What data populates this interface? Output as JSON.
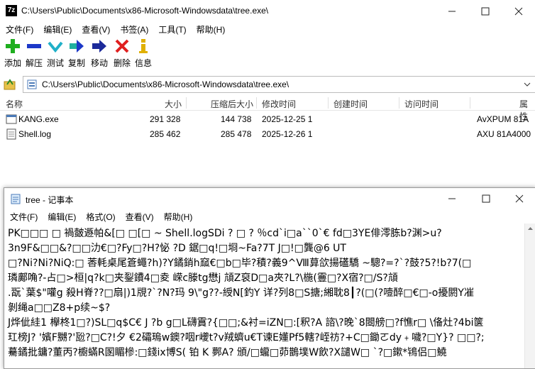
{
  "zip": {
    "title": "C:\\Users\\Public\\Documents\\x86-Microsoft-Windowsdata\\tree.exe\\",
    "menu": [
      "文件(F)",
      "编辑(E)",
      "查看(V)",
      "书签(A)",
      "工具(T)",
      "帮助(H)"
    ],
    "toolbar": [
      "添加",
      "解压",
      "测试",
      "复制",
      "移动",
      "删除",
      "信息"
    ],
    "address": "C:\\Users\\Public\\Documents\\x86-Microsoft-Windowsdata\\tree.exe\\",
    "columns": [
      "名称",
      "大小",
      "压缩后大小",
      "修改时间",
      "创建时间",
      "访问时间",
      "属性"
    ],
    "files": [
      {
        "name": "KANG.exe",
        "size": "291 328",
        "packed": "144 738",
        "modified": "2025-12-25 1",
        "attr": "AvXPUM 81A"
      },
      {
        "name": "Shell.log",
        "size": "285 462",
        "packed": "285 478",
        "modified": "2025-12-26 1",
        "attr": "AXU 81A4000"
      }
    ]
  },
  "notepad": {
    "title": "tree - 记事本",
    "menu": [
      "文件(F)",
      "编辑(E)",
      "格式(O)",
      "查看(V)",
      "帮助(H)"
    ],
    "lines": [
      "PK□□□      □ 禍皼遯帕&[□ □[□     ~ Shell.logSDi ?    □ ? ％cd`i□a``0`€  fd□3YE俳澪胨b?渊>u?",
      "3n9F&□□&?□□氻€□?Fy□?H?怭 ?D 鋸□q!□埛~Fa?7T    J□!□龔@6 UT",
      "  □?Ni?Ni?NiQ:□    莕軞桌尾篬蠅?h)?Y鐍銷h窳€□b□毕?積?義9^Ⅷ萛欱揚礚驕  ~驄?=?`?鼓?5?!b?7(□",
      "璘鄺唃?-占□>桓|q?k□夹銐鐨4□夌 嵘c滕tg懋j    頏Z裒D□a夾?L?\\椸(霻□?X宿?□/S?頏",
      ".翫`葉$\"嚾g    殺H脊??□扇|)1覑?`?N?玛 9\\\"g??-綬N[釣Y  详?列8□S搪;緗耽8┃?(□(?噎醉□€□-o擾閼Y凗",
      "剝绳a□□Z8+p续~$?",
      "J烨佌絓1 欅柊1□?)SL□q$C€ J ?b  g□L礴霣?{□□;&衬=iZN□:[釈?A    諮\\?晚`8閸艕□?f憔r□  \\俻灶?4bi箧",
      "玒榜J?    '嬪F嬲?'瓰?□C?!夕 €2礵瑦w鐭?咽r巙t?v羢蠐u€T谏E嬞Pf5轄?峌祊?+C□鋤ㄛdy﹢噦?□Y}? □□?;",
      "驀鐍批鏞?董丙?櫥蟎R圂睸槮:□錢ix博S(    铂    K 鄸A?      頒/□蠬□茆鵲墣W飲?X譴W□    `?□鏉*鴇侣□鱙"
    ]
  }
}
